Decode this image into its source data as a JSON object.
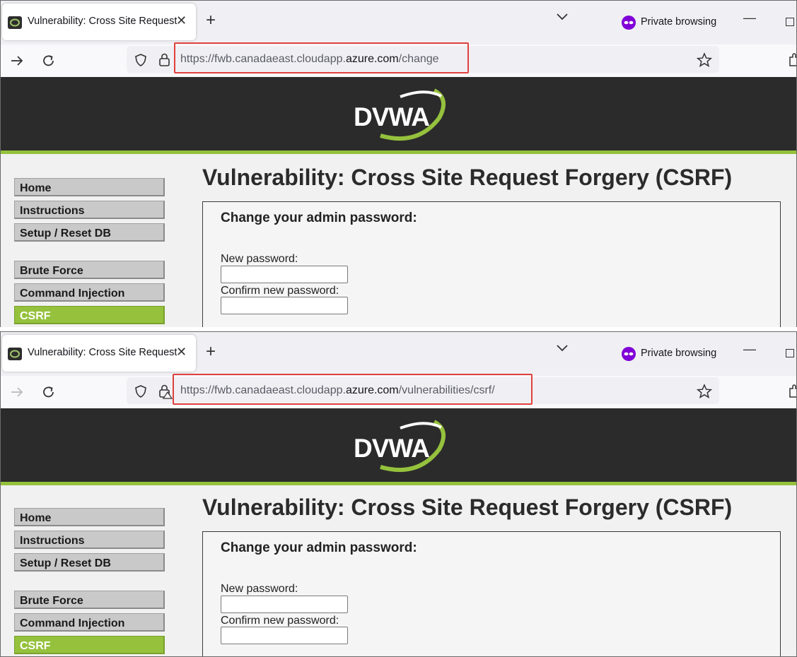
{
  "screens": [
    {
      "tab": {
        "title": "Vulnerability: Cross Site Request Forgery (CSRF)",
        "close": "✕"
      },
      "new_tab": "+",
      "private_label": "Private browsing",
      "window": {
        "minimize": "—"
      },
      "url": {
        "scheme_host_prefix": "https://fwb.canadaeast.cloudapp.",
        "host": "azure.com",
        "path": "/change"
      },
      "logo": "DVWA",
      "menu": {
        "home": "Home",
        "instructions": "Instructions",
        "setup": "Setup / Reset DB",
        "brute_force": "Brute Force",
        "command_injection": "Command Injection",
        "csrf": "CSRF"
      },
      "title": "Vulnerability: Cross Site Request Forgery (CSRF)",
      "form": {
        "heading": "Change your admin password:",
        "new_password_label": "New password:",
        "confirm_password_label": "Confirm new password:"
      }
    },
    {
      "tab": {
        "title": "Vulnerability: Cross Site Request Forgery (CSRF)",
        "close": "✕"
      },
      "new_tab": "+",
      "private_label": "Private browsing",
      "window": {
        "minimize": "—"
      },
      "url": {
        "scheme_host_prefix": "https://fwb.canadaeast.cloudapp.",
        "host": "azure.com",
        "path": "/vulnerabilities/csrf/"
      },
      "logo": "DVWA",
      "menu": {
        "home": "Home",
        "instructions": "Instructions",
        "setup": "Setup / Reset DB",
        "brute_force": "Brute Force",
        "command_injection": "Command Injection",
        "csrf": "CSRF"
      },
      "title": "Vulnerability: Cross Site Request Forgery (CSRF)",
      "form": {
        "heading": "Change your admin password:",
        "new_password_label": "New password:",
        "confirm_password_label": "Confirm new password:"
      }
    }
  ],
  "colors": {
    "highlight": "#e0413d",
    "dvwa_green": "#95c13d",
    "header_dark": "#2b2b2b",
    "private_purple": "#8000d7"
  },
  "icons": [
    "favicon-icon",
    "close-icon",
    "plus-icon",
    "chevron-down-icon",
    "private-mask-icon",
    "minimize-icon",
    "maximize-icon",
    "arrow-right-icon",
    "reload-icon",
    "shield-icon",
    "lock-icon",
    "star-icon",
    "extension-icon"
  ]
}
